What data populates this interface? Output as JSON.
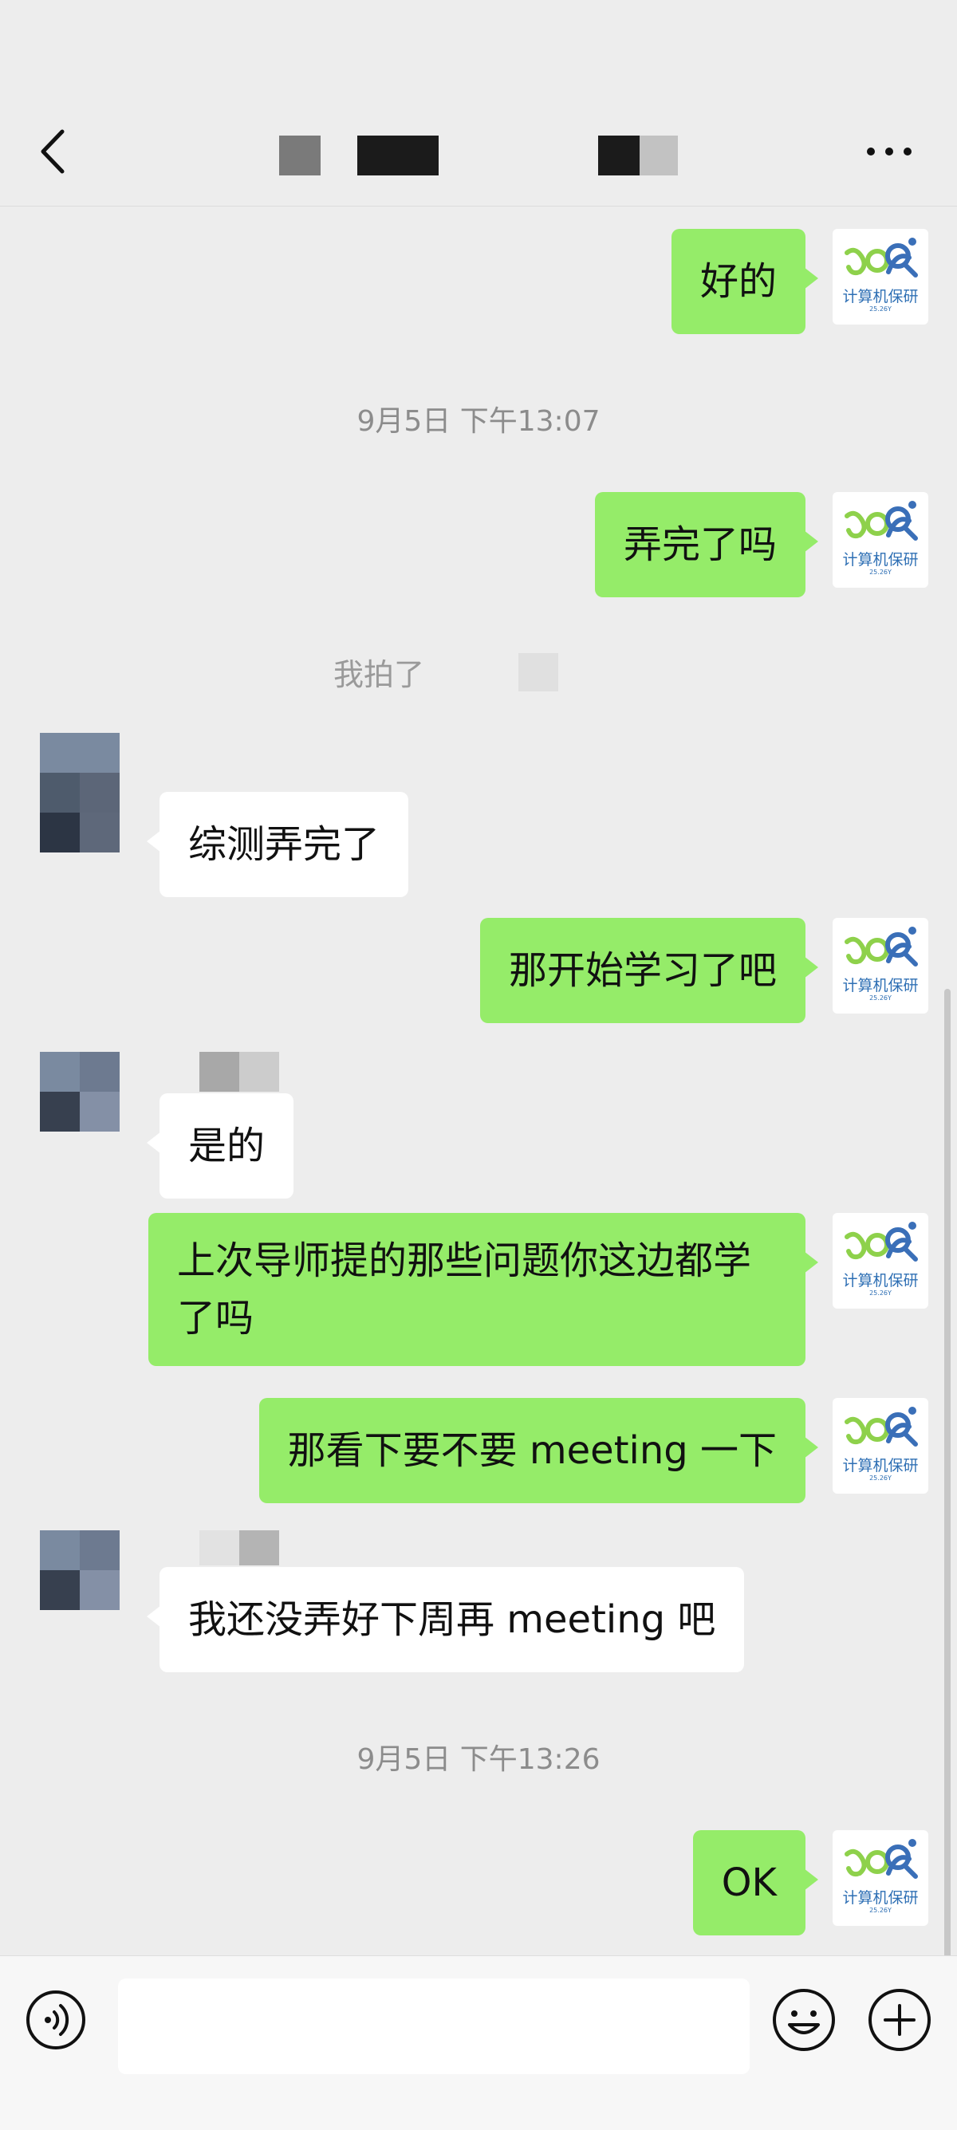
{
  "messages": {
    "m1": "好的",
    "t1": "9月5日 下午13:07",
    "m2": "弄完了吗",
    "sys1": "我拍了",
    "m3": "综测弄完了",
    "m4": "那开始学习了吧",
    "m5": "是的",
    "m6": "上次导师提的那些问题你这边都学了吗",
    "m7": "那看下要不要 meeting 一下",
    "m8": "我还没弄好下周再 meeting 吧",
    "t2": "9月5日 下午13:26",
    "m9": "OK"
  },
  "avatar": {
    "logo_text": "计算机保研",
    "logo_sub": "25.26Y"
  },
  "colors": {
    "outgoing_bubble": "#95ec69",
    "incoming_bubble": "#ffffff",
    "background": "#ededed"
  },
  "icons": {
    "back": "chevron-left-icon",
    "more": "more-icon",
    "voice": "voice-icon",
    "emoji": "emoji-icon",
    "plus": "plus-icon"
  }
}
